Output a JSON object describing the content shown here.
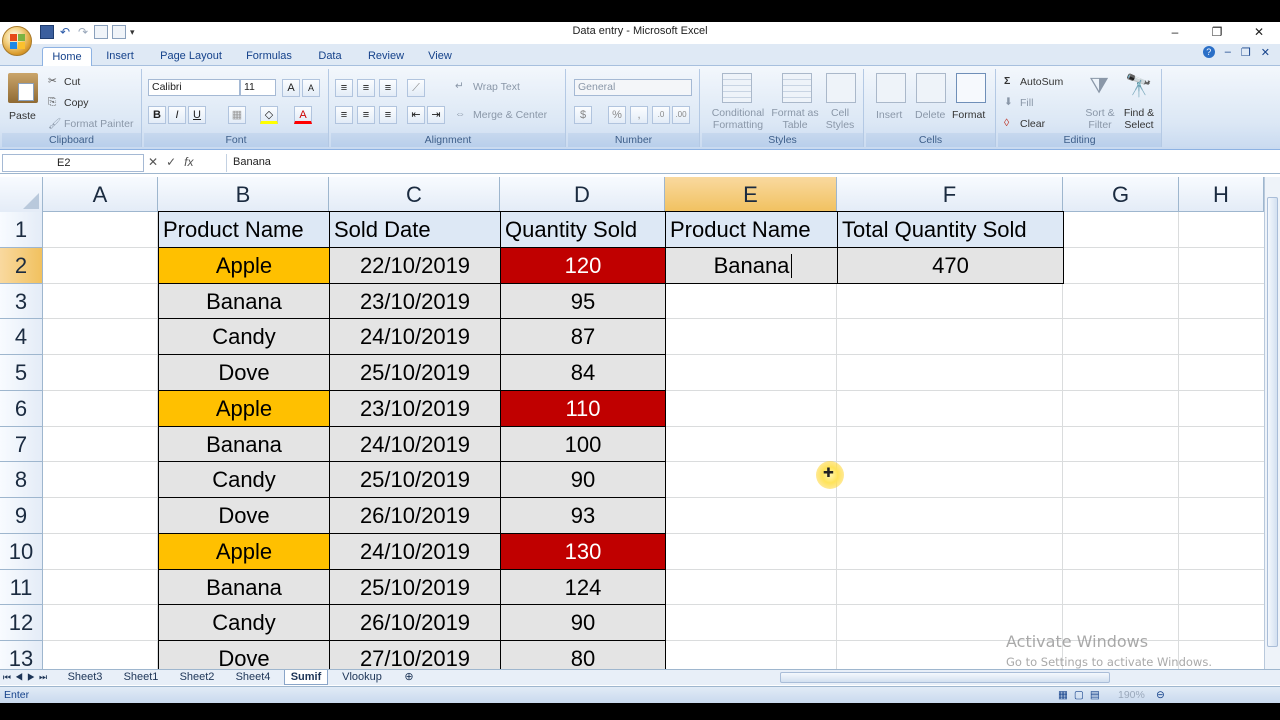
{
  "window": {
    "title": "Data entry - Microsoft Excel",
    "minimize": "–",
    "restore": "❐",
    "close": "✕"
  },
  "ribbon_tabs": [
    "Home",
    "Insert",
    "Page Layout",
    "Formulas",
    "Data",
    "Review",
    "View"
  ],
  "ribbon": {
    "clipboard": {
      "label": "Clipboard",
      "paste": "Paste",
      "cut": "Cut",
      "copy": "Copy",
      "format_painter": "Format Painter"
    },
    "font": {
      "label": "Font",
      "font_name": "Calibri",
      "font_size": "11",
      "bold": "B",
      "italic": "I",
      "underline": "U"
    },
    "alignment": {
      "label": "Alignment",
      "wrap_text": "Wrap Text",
      "merge_center": "Merge & Center"
    },
    "number": {
      "label": "Number",
      "format": "General",
      "currency": "$",
      "percent": "%",
      "comma": ","
    },
    "styles": {
      "label": "Styles",
      "conditional_formatting": "Conditional Formatting",
      "format_as_table": "Format as Table",
      "cell_styles": "Cell Styles"
    },
    "cells": {
      "label": "Cells",
      "insert": "Insert",
      "delete": "Delete",
      "format": "Format"
    },
    "editing": {
      "label": "Editing",
      "autosum": "AutoSum",
      "fill": "Fill",
      "clear": "Clear",
      "sort_filter": "Sort & Filter",
      "find_select": "Find & Select"
    }
  },
  "formula_bar": {
    "name_box": "E2",
    "fx": "fx",
    "content": "Banana"
  },
  "columns": [
    "A",
    "B",
    "C",
    "D",
    "E",
    "F",
    "G",
    "H"
  ],
  "rows": [
    "1",
    "2",
    "3",
    "4",
    "5",
    "6",
    "7",
    "8",
    "9",
    "10",
    "11",
    "12",
    "13"
  ],
  "table": {
    "headers": [
      "Product Name",
      "Sold Date",
      "Quantity Sold"
    ],
    "rows": [
      [
        "Apple",
        "22/10/2019",
        "120"
      ],
      [
        "Banana",
        "23/10/2019",
        "95"
      ],
      [
        "Candy",
        "24/10/2019",
        "87"
      ],
      [
        "Dove",
        "25/10/2019",
        "84"
      ],
      [
        "Apple",
        "23/10/2019",
        "110"
      ],
      [
        "Banana",
        "24/10/2019",
        "100"
      ],
      [
        "Candy",
        "25/10/2019",
        "90"
      ],
      [
        "Dove",
        "26/10/2019",
        "93"
      ],
      [
        "Apple",
        "24/10/2019",
        "130"
      ],
      [
        "Banana",
        "25/10/2019",
        "124"
      ],
      [
        "Candy",
        "26/10/2019",
        "90"
      ],
      [
        "Dove",
        "27/10/2019",
        "80"
      ]
    ]
  },
  "summary": {
    "header_product": "Product Name",
    "header_total": "Total Quantity Sold",
    "product": "Banana",
    "total": "470"
  },
  "sheet_tabs": [
    "Sheet3",
    "Sheet1",
    "Sheet2",
    "Sheet4",
    "Sumif",
    "Vlookup"
  ],
  "active_sheet": "Sumif",
  "status": {
    "mode": "Enter",
    "zoom": "190%"
  },
  "watermark": {
    "line1": "Activate Windows",
    "line2": "Go to Settings to activate Windows."
  },
  "colors": {
    "highlight_orange": "#ffc000",
    "highlight_red": "#c00000",
    "header_blue": "#dde8f5",
    "row_gray": "#e4e4e4"
  }
}
